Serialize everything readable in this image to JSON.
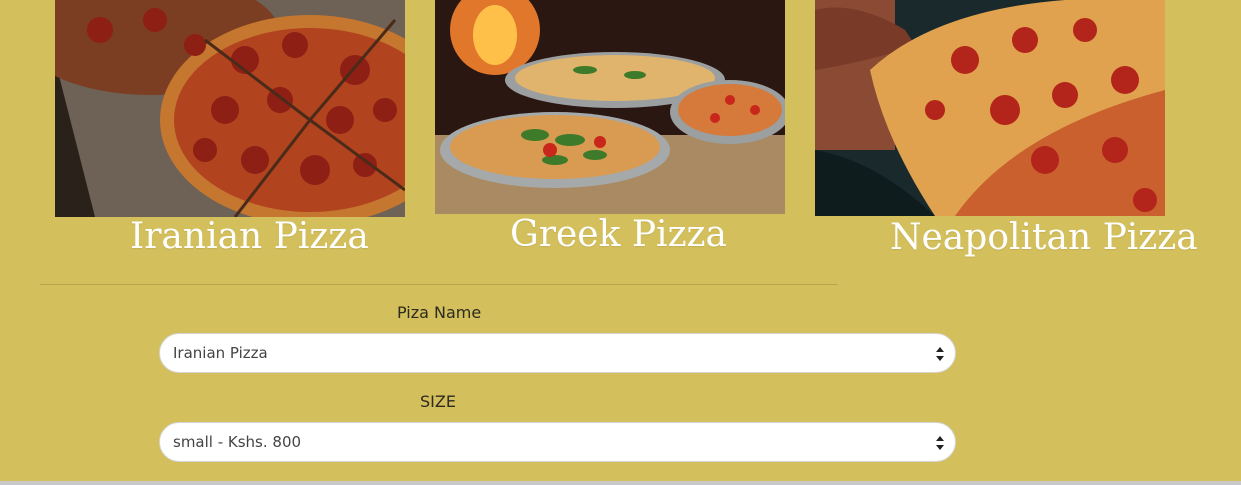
{
  "pizzas": [
    {
      "name": "Iranian Pizza",
      "image": "pepperoni-pizza-photo"
    },
    {
      "name": "Greek Pizza",
      "image": "pizzas-on-stands-photo"
    },
    {
      "name": "Neapolitan Pizza",
      "image": "pizza-slice-hand-photo"
    }
  ],
  "form": {
    "name_label": "Piza Name",
    "name_value": "Iranian Pizza",
    "size_label": "SIZE",
    "size_value": "small - Kshs. 800"
  },
  "colors": {
    "background": "#d3bf5b",
    "title_text": "#ffffff"
  }
}
